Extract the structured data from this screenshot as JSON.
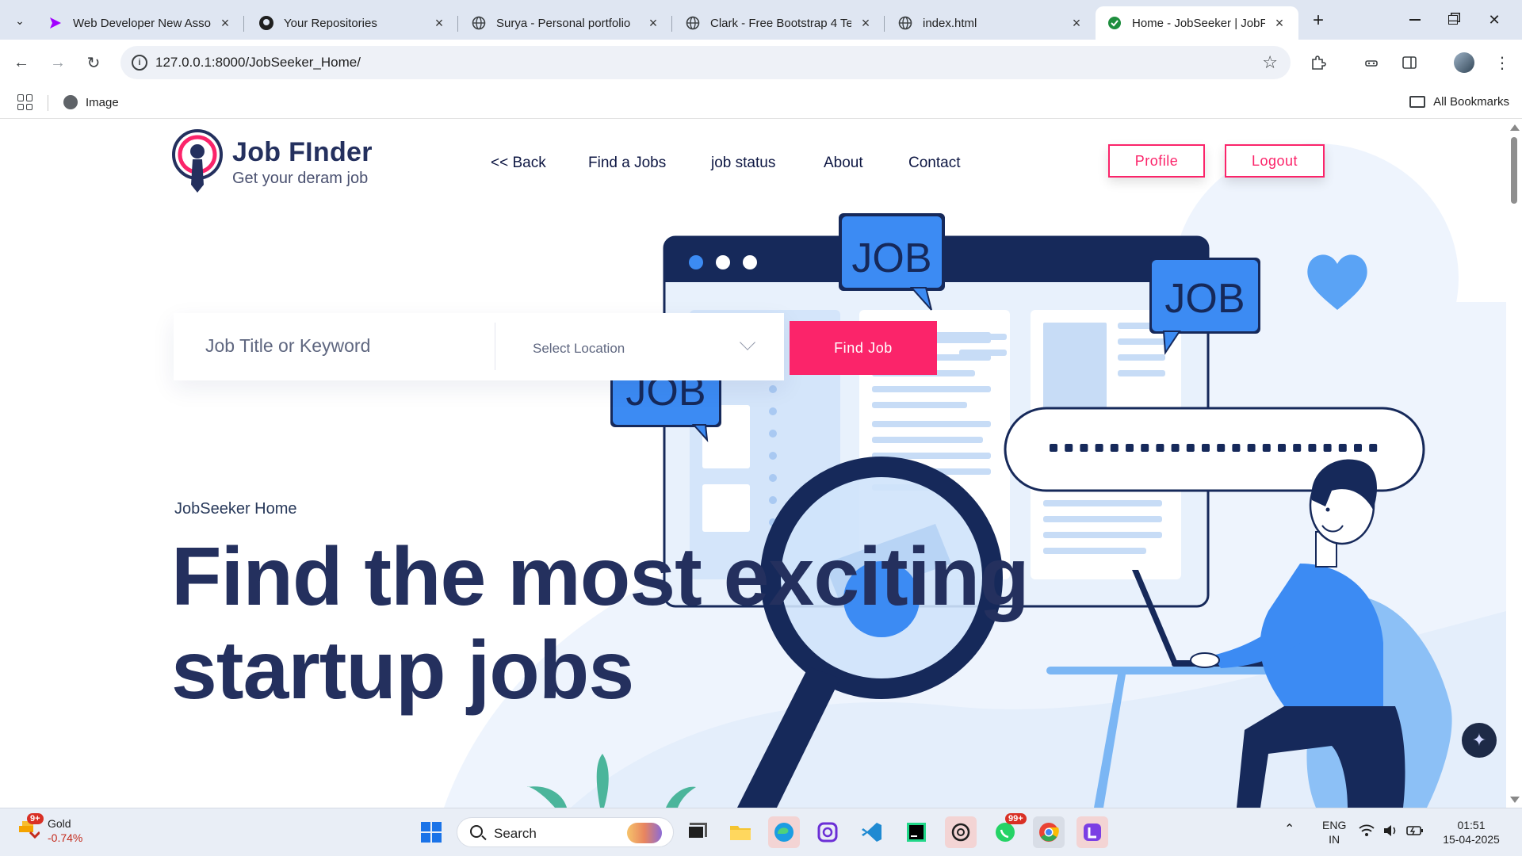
{
  "browser": {
    "tabs": [
      {
        "title": "Web Developer New Associ",
        "icon": "accenture-icon",
        "active": false
      },
      {
        "title": "Your Repositories",
        "icon": "github-icon",
        "active": false
      },
      {
        "title": "Surya - Personal portfolio",
        "icon": "globe-icon",
        "active": false
      },
      {
        "title": "Clark - Free Bootstrap 4 Te",
        "icon": "globe-icon",
        "active": false
      },
      {
        "title": "index.html",
        "icon": "globe-icon",
        "active": false
      },
      {
        "title": "Home - JobSeeker | JobFin",
        "icon": "check-circle-icon",
        "active": true
      }
    ],
    "url": "127.0.0.1:8000/JobSeeker_Home/",
    "bookmarks": {
      "item": "Image",
      "all": "All Bookmarks"
    }
  },
  "site": {
    "logo": {
      "name": "Job FInder",
      "tagline": "Get your deram job"
    },
    "nav": {
      "back": "<< Back",
      "find": "Find a Jobs",
      "status": "job status",
      "about": "About",
      "contact": "Contact"
    },
    "buttons": {
      "profile": "Profile",
      "logout": "Logout",
      "find_job": "Find Job"
    },
    "search": {
      "keyword_placeholder": "Job Title or Keyword",
      "location_placeholder": "Select Location"
    },
    "breadcrumb": "JobSeeker Home",
    "hero": {
      "line1": "Find the most exciting",
      "line2": "startup jobs"
    },
    "illustration": {
      "bubble_text": "JOB"
    }
  },
  "taskbar": {
    "weather": {
      "name": "Gold",
      "change": "-0.74%",
      "badge": "9+"
    },
    "search_label": "Search",
    "whatsapp_badge": "99+",
    "lang": {
      "line1": "ENG",
      "line2": "IN"
    },
    "time": "01:51",
    "date": "15-04-2025"
  },
  "colors": {
    "accent": "#fb246a",
    "navy": "#24305e",
    "illustration_blue": "#3c8bf3"
  }
}
